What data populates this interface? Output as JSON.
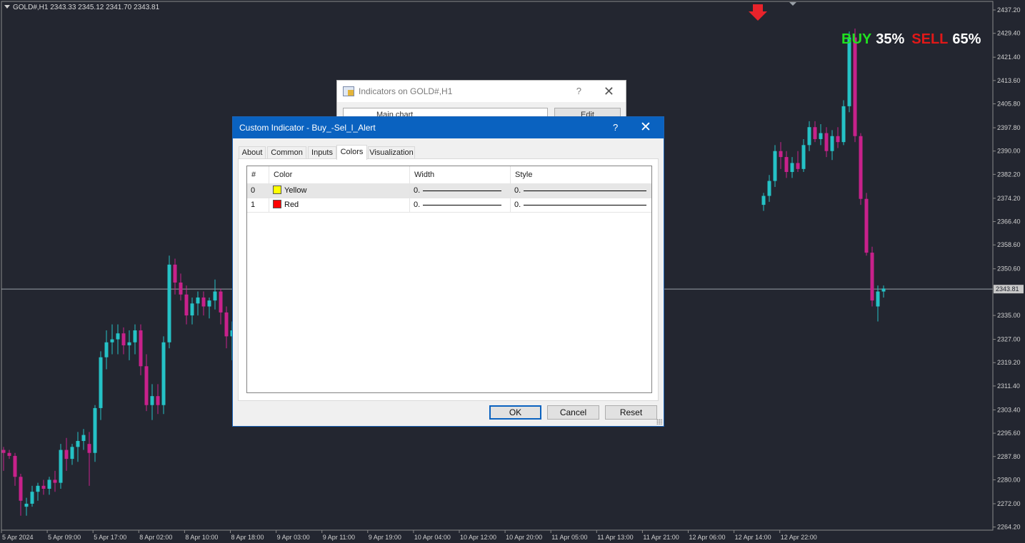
{
  "chart": {
    "symbol_line": "GOLD#,H1  2343.33 2345.12 2341.70 2343.81",
    "current_price": "2343.81",
    "price_axis": [
      "2437.20",
      "2429.40",
      "2421.40",
      "2413.60",
      "2405.80",
      "2397.80",
      "2390.00",
      "2382.20",
      "2374.20",
      "2366.40",
      "2358.60",
      "2350.60",
      "2335.00",
      "2327.00",
      "2319.20",
      "2311.40",
      "2303.40",
      "2295.60",
      "2287.80",
      "2280.00",
      "2272.00",
      "2264.20"
    ],
    "time_axis": [
      "5 Apr 2024",
      "5 Apr 09:00",
      "5 Apr 17:00",
      "8 Apr 02:00",
      "8 Apr 10:00",
      "8 Apr 18:00",
      "9 Apr 03:00",
      "9 Apr 11:00",
      "9 Apr 19:00",
      "10 Apr 04:00",
      "10 Apr 12:00",
      "10 Apr 20:00",
      "11 Apr 05:00",
      "11 Apr 13:00",
      "11 Apr 21:00",
      "12 Apr 06:00",
      "12 Apr 14:00",
      "12 Apr 22:00"
    ],
    "buy_label": "BUY",
    "buy_pct": "35%",
    "sell_label": "SELL",
    "sell_pct": "65%",
    "colors": {
      "bull": "#25c2c6",
      "bear": "#c8218b",
      "background": "#232630",
      "arrow": "#e8232b"
    }
  },
  "bg_dialog": {
    "title": "Indicators on GOLD#,H1",
    "help": "?",
    "row_label": "Main chart",
    "edit_label": "Edit"
  },
  "dialog": {
    "title": "Custom Indicator - Buy_-Sel_l_Alert",
    "help": "?",
    "close": "✕",
    "tabs": [
      "About",
      "Common",
      "Inputs",
      "Colors",
      "Visualization"
    ],
    "active_tab": "Colors",
    "columns": [
      "#",
      "Color",
      "Width",
      "Style"
    ],
    "rows": [
      {
        "index": "0",
        "color_name": "Yellow",
        "swatch": "#ffff00",
        "width": "0.",
        "style": "0."
      },
      {
        "index": "1",
        "color_name": "Red",
        "swatch": "#ff0000",
        "width": "0.",
        "style": "0."
      }
    ],
    "ok_label": "OK",
    "cancel_label": "Cancel",
    "reset_label": "Reset"
  }
}
